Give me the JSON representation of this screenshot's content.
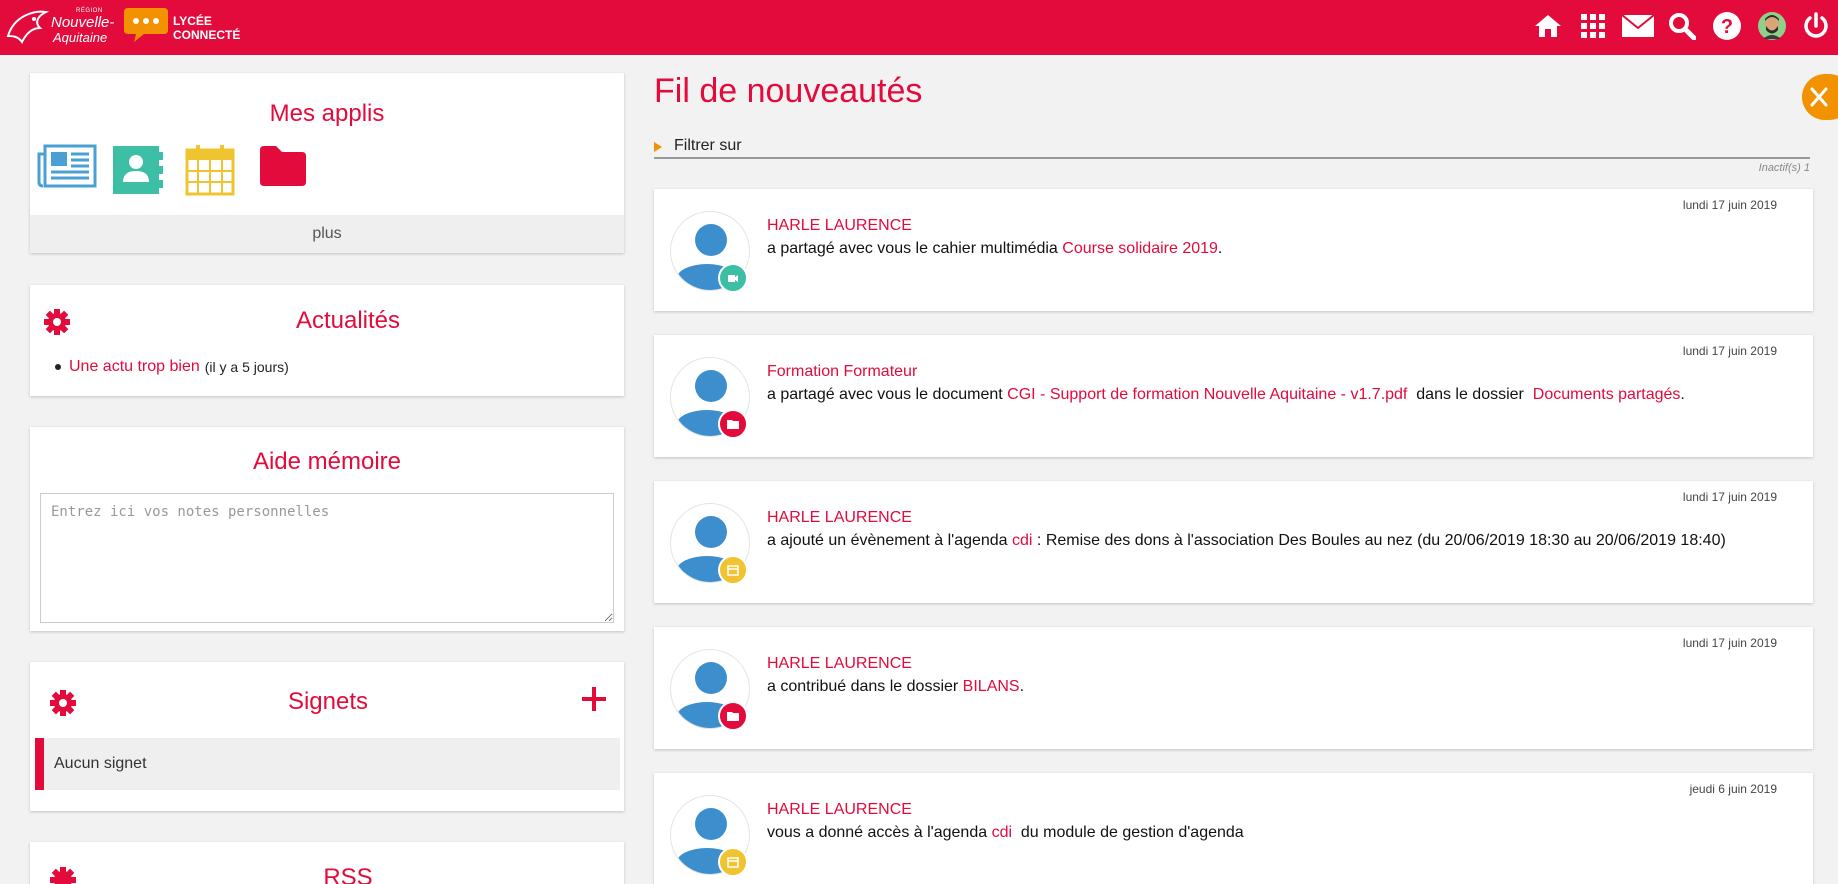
{
  "colors": {
    "brand": "#e30a3c",
    "accent_orange": "#f39200",
    "blue": "#4a9fd5",
    "teal": "#3cbfa4",
    "yellow": "#f0c330"
  },
  "header": {
    "region_small": "RÉGION",
    "region_line1": "Nouvelle-",
    "region_line2": "Aquitaine",
    "lycee_line1": "LYCÉE",
    "lycee_line2": "CONNECTÉ",
    "icons": [
      "home-icon",
      "apps-grid-icon",
      "mail-icon",
      "search-icon",
      "help-icon",
      "user-avatar",
      "power-icon"
    ]
  },
  "applis": {
    "title": "Mes applis",
    "apps": [
      "news-icon",
      "contacts-icon",
      "calendar-icon",
      "folder-icon"
    ],
    "more_label": "plus"
  },
  "actualites": {
    "title": "Actualités",
    "items": [
      {
        "link": "Une actu trop bien",
        "meta": "(il y a 5 jours)"
      }
    ]
  },
  "aide": {
    "title": "Aide mémoire",
    "placeholder": "Entrez ici vos notes personnelles"
  },
  "signets": {
    "title": "Signets",
    "empty_label": "Aucun signet"
  },
  "rss": {
    "title": "RSS"
  },
  "feed": {
    "title": "Fil de nouveautés",
    "filter_label": "Filtrer sur",
    "inactifs": "Inactif(s) 1",
    "items": [
      {
        "date": "lundi 17 juin 2019",
        "author": "HARLE LAURENCE",
        "badge": "multimedia-icon",
        "t1": "a partagé avec vous le cahier multimédia ",
        "l1": "Course solidaire 2019",
        "t2": ".",
        "l2": "",
        "t3": ""
      },
      {
        "date": "lundi 17 juin 2019",
        "author": "Formation Formateur",
        "badge": "folder-icon",
        "t1": "a partagé avec vous le document ",
        "l1": "CGI - Support de formation Nouvelle Aquitaine - v1.7.pdf",
        "t2": "  dans le dossier  ",
        "l2": "Documents partagés",
        "t3": "."
      },
      {
        "date": "lundi 17 juin 2019",
        "author": "HARLE LAURENCE",
        "badge": "calendar-icon",
        "t1": "a ajouté un évènement à l'agenda ",
        "l1": "cdi",
        "t2": " : Remise des dons à l'association Des Boules au nez (du 20/06/2019 18:30 au 20/06/2019 18:40)",
        "l2": "",
        "t3": ""
      },
      {
        "date": "lundi 17 juin 2019",
        "author": "HARLE LAURENCE",
        "badge": "folder-icon",
        "t1": "a contribué dans le dossier ",
        "l1": "BILANS",
        "t2": ".",
        "l2": "",
        "t3": ""
      },
      {
        "date": "jeudi 6 juin 2019",
        "author": "HARLE LAURENCE",
        "badge": "calendar-icon",
        "t1": "vous a donné accès à l'agenda ",
        "l1": "cdi",
        "t2": "  du module de gestion d'agenda",
        "l2": "",
        "t3": ""
      }
    ]
  }
}
